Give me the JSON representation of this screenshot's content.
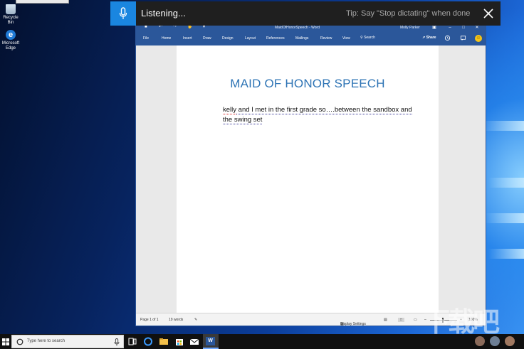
{
  "desktop": {
    "icons": [
      {
        "label": "Recycle Bin",
        "icon": "recycle-bin-icon"
      },
      {
        "label": "Microsoft Edge",
        "icon": "edge-icon"
      }
    ]
  },
  "dictation": {
    "status": "Listening...",
    "tip": "Tip: Say \"Stop dictating\" when done",
    "accent": "#1a86e0"
  },
  "word": {
    "title": "MaidOfHonorSpeech  -  Word",
    "user": "Molly Parker",
    "tabs": [
      "File",
      "Home",
      "Insert",
      "Draw",
      "Design",
      "Layout",
      "References",
      "Mailings",
      "Review",
      "View"
    ],
    "search": "Search",
    "share": "Share",
    "document": {
      "heading": "MAID OF HONOR SPEECH",
      "body_first_word": "kelly",
      "body_rest": " and I met in the first grade so….between the sandbox and the swing set"
    },
    "status": {
      "page": "Page 1 of 1",
      "words": "19 words",
      "display_settings": "Display Settings",
      "zoom": "100%"
    },
    "brand_color": "#2b579a"
  },
  "taskbar": {
    "search_placeholder": "Type here to search"
  },
  "watermark": "下载吧"
}
